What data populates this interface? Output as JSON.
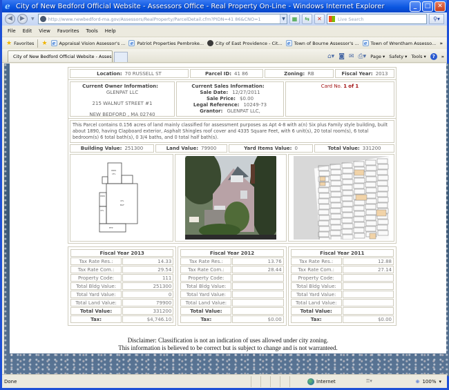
{
  "window": {
    "title": "City of New Bedford Official Website - Assessors Office - Real Property On-Line - Windows Internet Explorer",
    "address_domain": "http://www.newbedford-ma.gov",
    "address_path": "/Assessors/RealProperty/ParcelDetail.cfm?PIDN=41 86&CNO=1",
    "search_placeholder": "Live Search"
  },
  "menu": [
    "File",
    "Edit",
    "View",
    "Favorites",
    "Tools",
    "Help"
  ],
  "favorites": {
    "label": "Favorites",
    "items": [
      "Appraisal Vision Assessor's ...",
      "Patriot Properties Pembroke...",
      "City of East Providence - Cit...",
      "Town of Bourne Assessor's ...",
      "Town of Wrentham Assesso..."
    ]
  },
  "tab": {
    "label": "City of New Bedford Official Website - Assessors Offic..."
  },
  "commandbar": {
    "page": "Page",
    "safety": "Safety",
    "tools": "Tools"
  },
  "parcel": {
    "location_label": "Location:",
    "location": "70 RUSSELL ST",
    "parcel_id_label": "Parcel ID:",
    "parcel_id": "41 86",
    "zoning_label": "Zoning:",
    "zoning": "RB",
    "fiscal_year_label": "Fiscal Year:",
    "fiscal_year": "2013"
  },
  "owner": {
    "heading": "Current Owner Information:",
    "name": "GLENPAT LLC",
    "street": "215 WALNUT STREET #1",
    "city": "NEW BEDFORD , MA 02740"
  },
  "sales": {
    "heading": "Current Sales Information:",
    "sale_date_label": "Sale Date:",
    "sale_date": "12/27/2011",
    "sale_price_label": "Sale Price:",
    "sale_price": "$0.00",
    "legal_ref_label": "Legal Reference:",
    "legal_ref": "10249-73",
    "grantor_label": "Grantor:",
    "grantor": "GLENPAT LLC,"
  },
  "card": {
    "prefix": "Card No.",
    "num": "1",
    "of": "of",
    "total": "1"
  },
  "description": "This Parcel contains 0.156 acres of land mainly classified for assessment purposes as Apt 4-8 with a(n) Six plus Family style building, built about 1890, having Clapboard exterior, Asphalt Shingles roof cover and 4335 Square Feet, with 6 unit(s), 20 total room(s), 6 total bedroom(s) 6 total bath(s), 0 3/4 baths, and 0 total half bath(s).",
  "values": {
    "building_label": "Building Value:",
    "building": "251300",
    "land_label": "Land Value:",
    "land": "79900",
    "yard_label": "Yard Items Value:",
    "yard": "0",
    "total_label": "Total Value:",
    "total": "331200"
  },
  "images": {
    "sketch": "building-sketch",
    "photo": "house-photo",
    "map": "parcel-map"
  },
  "row_labels": [
    "Tax Rate Res.:",
    "Tax Rate Com.:",
    "Property Code:",
    "Total Bldg Value:",
    "Total Yard Value:",
    "Total Land Value:",
    "Total Value:",
    "Tax:"
  ],
  "fiscal_years": [
    {
      "title": "Fiscal Year 2013",
      "values": [
        "14.33",
        "29.54",
        "111",
        "251300",
        "0",
        "79900",
        "331200",
        "$4,746.10"
      ]
    },
    {
      "title": "Fiscal Year 2012",
      "values": [
        "13.76",
        "28.44",
        "",
        "",
        "",
        "",
        "",
        "$0.00"
      ]
    },
    {
      "title": "Fiscal Year 2011",
      "values": [
        "12.88",
        "27.14",
        "",
        "",
        "",
        "",
        "",
        "$0.00"
      ]
    }
  ],
  "disclaimer": {
    "line1": "Disclaimer: Classification is not an indication of uses allowed under city zoning.",
    "line2": "This information is believed to be correct but is subject to change and is not warranteed."
  },
  "status": {
    "text": "Done",
    "zone": "Internet",
    "zoom": "100%"
  }
}
